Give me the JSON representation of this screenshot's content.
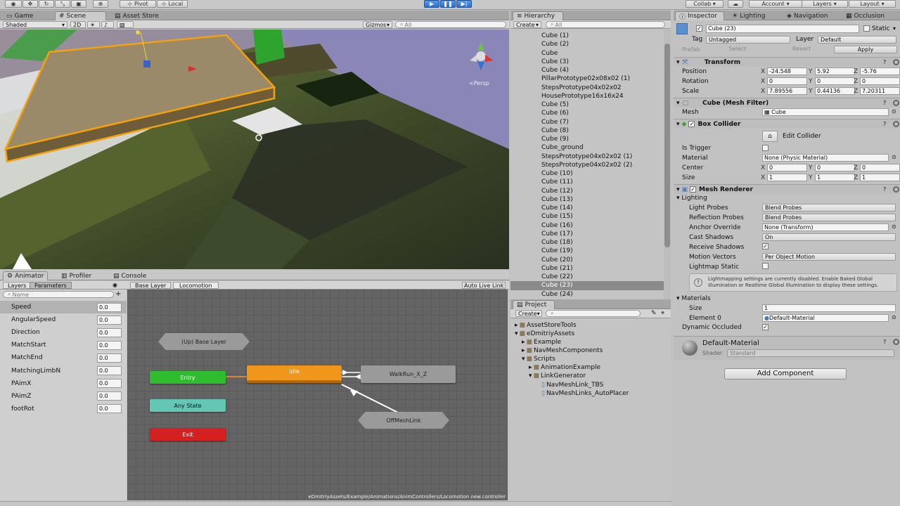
{
  "toolbar": {
    "pivot": "Pivot",
    "local": "Local",
    "collab": "Collab ▾",
    "account": "Account",
    "layers": "Layers",
    "layout": "Layout"
  },
  "left_tabs": [
    "Game",
    "Scene",
    "Asset Store"
  ],
  "scene_toolbar": {
    "shading": "Shaded",
    "mode_2d": "2D",
    "gizmos": "Gizmos",
    "search_placeholder": "All",
    "persp": "Persp"
  },
  "animator_tabs": [
    "Animator",
    "Profiler",
    "Console"
  ],
  "animator": {
    "subtabs": [
      "Layers",
      "Parameters"
    ],
    "search_placeholder": "Name",
    "breadcrumb": [
      "Base Layer",
      "Locomotion"
    ],
    "auto_live_link": "Auto Live Link",
    "path": "eDmitriyAssets/Example/Animations/AnimControllers/Locomotion new.controller",
    "parameters": [
      {
        "name": "Speed",
        "value": "0.0"
      },
      {
        "name": "AngularSpeed",
        "value": "0.0"
      },
      {
        "name": "Direction",
        "value": "0.0"
      },
      {
        "name": "MatchStart",
        "value": "0.0"
      },
      {
        "name": "MatchEnd",
        "value": "0.0"
      },
      {
        "name": "MatchingLimbN",
        "value": "0.0"
      },
      {
        "name": "PAimX",
        "value": "0.0"
      },
      {
        "name": "PAimZ",
        "value": "0.0"
      },
      {
        "name": "footRot",
        "value": "0.0"
      }
    ],
    "nodes": {
      "up": "(Up) Base Layer",
      "entry": "Entry",
      "idle": "Idle",
      "walkrun": "WalkRun_X_Z",
      "anystate": "Any State",
      "offmesh": "OffMeshLink",
      "exit": "Exit"
    },
    "colors": {
      "entry": "#2ebd2e",
      "idle": "#f0961a",
      "anystate": "#63c7b4",
      "exit": "#d42020"
    }
  },
  "hierarchy": {
    "title": "Hierarchy",
    "create": "Create",
    "search_placeholder": "All",
    "items": [
      "Cube (1)",
      "Cube (2)",
      "Cube",
      "Cube (3)",
      "Cube (4)",
      "PillarPrototype02x08x02 (1)",
      "StepsPrototype04x02x02",
      "HousePrototype16x16x24",
      "Cube (5)",
      "Cube (6)",
      "Cube (7)",
      "Cube (8)",
      "Cube (9)",
      "Cube_ground",
      "StepsPrototype04x02x02 (1)",
      "StepsPrototype04x02x02 (2)",
      "Cube (10)",
      "Cube (11)",
      "Cube (12)",
      "Cube (13)",
      "Cube (14)",
      "Cube (15)",
      "Cube (16)",
      "Cube (17)",
      "Cube (18)",
      "Cube (19)",
      "Cube (20)",
      "Cube (21)",
      "Cube (22)",
      "Cube (23)",
      "Cube (24)"
    ],
    "selected": "Cube (23)"
  },
  "project": {
    "title": "Project",
    "create": "Create",
    "items": [
      "AssetStoreTools",
      "eDmitriyAssets",
      "Example",
      "NavMeshComponents",
      "Scripts",
      "AnimationExample",
      "LinkGenerator",
      "NavMeshLink_TBS",
      "NavMeshLinks_AutoPlacer"
    ]
  },
  "inspector_tabs": [
    "Inspector",
    "Lighting",
    "Navigation",
    "Occlusion"
  ],
  "inspector": {
    "object_name": "Cube (23)",
    "static": "Static",
    "tag_label": "Tag",
    "tag": "Untagged",
    "layer_label": "Layer",
    "layer": "Default",
    "prefab": "Prefab",
    "select": "Select",
    "revert": "Revert",
    "apply": "Apply",
    "transform": {
      "title": "Transform",
      "position_label": "Position",
      "rotation_label": "Rotation",
      "scale_label": "Scale",
      "position": [
        "-24.548",
        "5.92",
        "-5.76"
      ],
      "rotation": [
        "0",
        "0",
        "0"
      ],
      "scale": [
        "7.89556",
        "0.44136",
        "7.20311"
      ]
    },
    "mesh_filter": {
      "title": "Cube (Mesh Filter)",
      "mesh_label": "Mesh",
      "mesh": "Cube"
    },
    "box_collider": {
      "title": "Box Collider",
      "edit_collider": "Edit Collider",
      "is_trigger": "Is Trigger",
      "material_label": "Material",
      "material": "None (Physic Material)",
      "center_label": "Center",
      "center": [
        "0",
        "0",
        "0"
      ],
      "size_label": "Size",
      "size": [
        "1",
        "1",
        "1"
      ]
    },
    "mesh_renderer": {
      "title": "Mesh Renderer",
      "lighting": "Lighting",
      "light_probes_label": "Light Probes",
      "light_probes": "Blend Probes",
      "reflection_probes_label": "Reflection Probes",
      "reflection_probes": "Blend Probes",
      "anchor_override_label": "Anchor Override",
      "anchor_override": "None (Transform)",
      "cast_shadows_label": "Cast Shadows",
      "cast_shadows": "On",
      "receive_shadows": "Receive Shadows",
      "motion_vectors_label": "Motion Vectors",
      "motion_vectors": "Per Object Motion",
      "lightmap_static": "Lightmap Static",
      "info": "Lightmapping settings are currently disabled. Enable Baked Global Illumination or Realtime Global Illumination to display these settings.",
      "materials": "Materials",
      "mat_size_label": "Size",
      "mat_size": "1",
      "element0_label": "Element 0",
      "element0": "Default-Material",
      "dynamic_occluded": "Dynamic Occluded"
    },
    "material": {
      "name": "Default-Material",
      "shader_label": "Shader",
      "shader": "Standard"
    },
    "add_component": "Add Component"
  }
}
